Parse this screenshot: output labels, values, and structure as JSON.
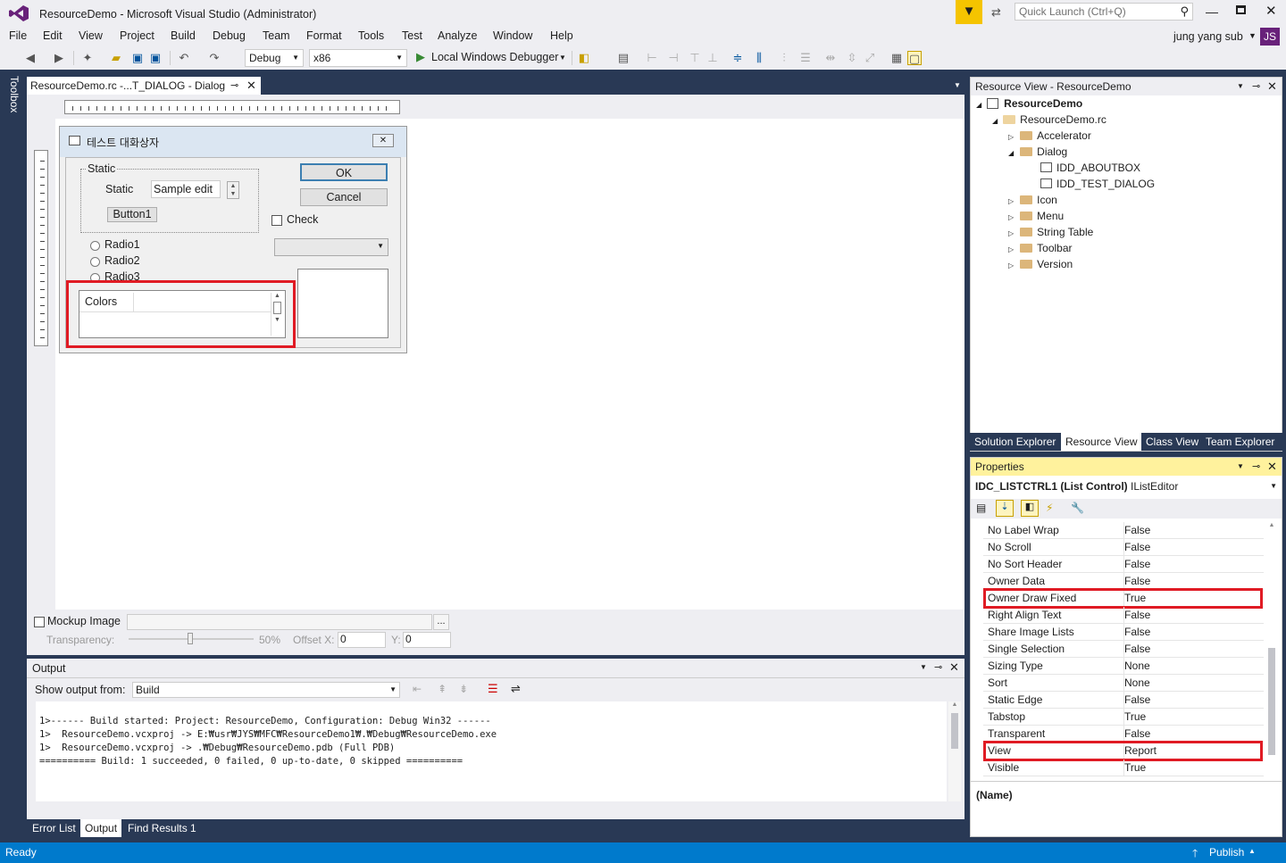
{
  "app": {
    "title": "ResourceDemo - Microsoft Visual Studio (Administrator)",
    "quick_launch_placeholder": "Quick Launch (Ctrl+Q)",
    "user": "jung yang sub",
    "user_initials": "JS",
    "accent": "#007acc"
  },
  "menu": [
    "File",
    "Edit",
    "View",
    "Project",
    "Build",
    "Debug",
    "Team",
    "Format",
    "Tools",
    "Test",
    "Analyze",
    "Window",
    "Help"
  ],
  "toolbar": {
    "config": "Debug",
    "platform": "x86",
    "debugger": "Local Windows Debugger"
  },
  "toolbox_label": "Toolbox",
  "doc_tab": {
    "label": "ResourceDemo.rc -...T_DIALOG - Dialog"
  },
  "dialog": {
    "title": "테스트 대화상자",
    "group_label": "Static",
    "static_label": "Static",
    "edit_text": "Sample edit",
    "button1": "Button1",
    "ok": "OK",
    "cancel": "Cancel",
    "check": "Check",
    "radios": [
      "Radio1",
      "Radio2",
      "Radio3"
    ],
    "list_header": "Colors"
  },
  "mockup": {
    "label": "Mockup Image",
    "transparency_label": "Transparency:",
    "transparency_value": "50%",
    "offset_x_label": "Offset X:",
    "offset_x": "0",
    "y_label": "Y:",
    "y": "0",
    "browse": "..."
  },
  "output": {
    "title": "Output",
    "show_from_label": "Show output from:",
    "source": "Build",
    "lines": [
      "1>------ Build started: Project: ResourceDemo, Configuration: Debug Win32 ------",
      "1>  ResourceDemo.vcxproj -> E:₩usr₩JYS₩MFC₩ResourceDemo1₩.₩Debug₩ResourceDemo.exe",
      "1>  ResourceDemo.vcxproj -> .₩Debug₩ResourceDemo.pdb (Full PDB)",
      "========== Build: 1 succeeded, 0 failed, 0 up-to-date, 0 skipped =========="
    ]
  },
  "bottom_tabs": [
    "Error List",
    "Output",
    "Find Results 1"
  ],
  "status": {
    "left": "Ready",
    "publish": "Publish"
  },
  "resource_view": {
    "title": "Resource View - ResourceDemo",
    "root": "ResourceDemo",
    "rc": "ResourceDemo.rc",
    "items": [
      {
        "label": "Accelerator",
        "indent": 2,
        "expanded": false,
        "kind": "folder"
      },
      {
        "label": "Dialog",
        "indent": 2,
        "expanded": true,
        "kind": "folder"
      },
      {
        "label": "IDD_ABOUTBOX",
        "indent": 3,
        "kind": "dialog"
      },
      {
        "label": "IDD_TEST_DIALOG",
        "indent": 3,
        "kind": "dialog"
      },
      {
        "label": "Icon",
        "indent": 2,
        "expanded": false,
        "kind": "folder"
      },
      {
        "label": "Menu",
        "indent": 2,
        "expanded": false,
        "kind": "folder"
      },
      {
        "label": "String Table",
        "indent": 2,
        "expanded": false,
        "kind": "folder"
      },
      {
        "label": "Toolbar",
        "indent": 2,
        "expanded": false,
        "kind": "folder"
      },
      {
        "label": "Version",
        "indent": 2,
        "expanded": false,
        "kind": "folder"
      }
    ],
    "tabs": [
      "Solution Explorer",
      "Resource View",
      "Class View",
      "Team Explorer"
    ]
  },
  "properties": {
    "title": "Properties",
    "object": "IDC_LISTCTRL1 (List Control)",
    "editor": "IListEditor",
    "rows": [
      {
        "name": "No Label Wrap",
        "value": "False"
      },
      {
        "name": "No Scroll",
        "value": "False"
      },
      {
        "name": "No Sort Header",
        "value": "False"
      },
      {
        "name": "Owner Data",
        "value": "False"
      },
      {
        "name": "Owner Draw Fixed",
        "value": "True",
        "highlight": true
      },
      {
        "name": "Right Align Text",
        "value": "False"
      },
      {
        "name": "Share Image Lists",
        "value": "False"
      },
      {
        "name": "Single Selection",
        "value": "False"
      },
      {
        "name": "Sizing Type",
        "value": "None"
      },
      {
        "name": "Sort",
        "value": "None"
      },
      {
        "name": "Static Edge",
        "value": "False"
      },
      {
        "name": "Tabstop",
        "value": "True"
      },
      {
        "name": "Transparent",
        "value": "False"
      },
      {
        "name": "View",
        "value": "Report",
        "highlight": true
      },
      {
        "name": "Visible",
        "value": "True"
      }
    ],
    "desc_name": "(Name)"
  }
}
